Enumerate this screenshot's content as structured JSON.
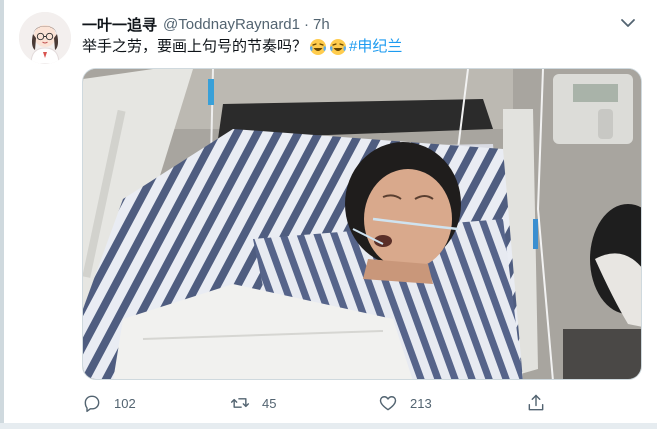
{
  "tweet": {
    "display_name": "一叶一追寻",
    "handle": "@ToddnayRaynard1",
    "separator": "·",
    "time": "7h",
    "text": "举手之劳，要画上句号的节奏吗？",
    "emojis": [
      "laughing-tears-emoji",
      "laughing-tears-emoji"
    ],
    "hashtag": "#申纪兰",
    "media_alt": "photo"
  },
  "actions": {
    "reply_count": "102",
    "retweet_count": "45",
    "like_count": "213"
  },
  "colors": {
    "accent": "#1d9bf0",
    "muted": "#536471",
    "border": "#cfd9de"
  }
}
